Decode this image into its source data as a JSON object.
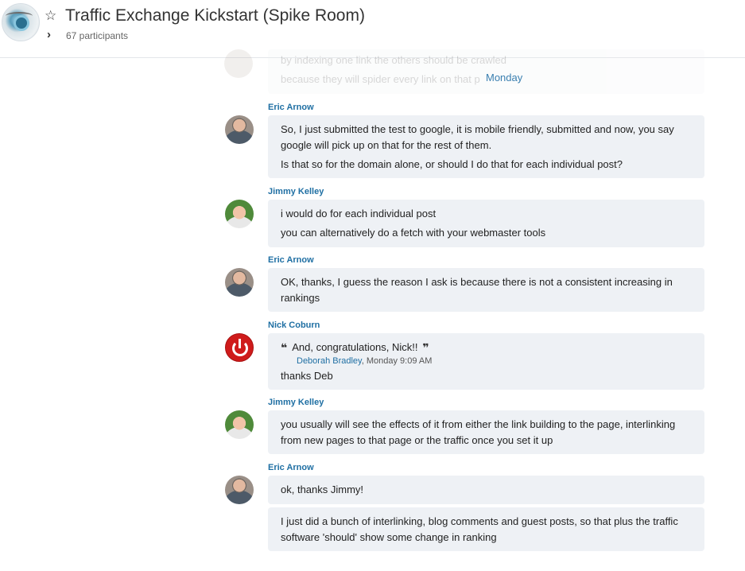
{
  "header": {
    "title": "Traffic Exchange Kickstart (Spike Room)",
    "participants": "67 participants",
    "star_icon": "star-outline-icon",
    "chevron_icon": "chevron-right-icon"
  },
  "faded": {
    "line1": "by indexing one link the others should be crawled",
    "line2": "because they will spider every link on that p"
  },
  "day_separator": "Monday",
  "messages": [
    {
      "sender": "Eric Arnow",
      "lines": [
        "So, I just submitted the test to google, it is mobile friendly, submitted and now, you say google will pick up on that for the rest of them.",
        "Is that so for the domain alone, or should I do that for each individual post?"
      ]
    },
    {
      "sender": "Jimmy Kelley",
      "lines": [
        "i would do for each individual post",
        "you can alternatively do a fetch with your webmaster tools"
      ]
    },
    {
      "sender": "Eric Arnow",
      "lines": [
        "OK, thanks, I guess the reason I ask is because there is not a consistent increasing in rankings"
      ]
    },
    {
      "sender": "Nick Coburn",
      "quote": {
        "text": "And, congratulations, Nick!!",
        "author": "Deborah Bradley",
        "time": ", Monday 9:09 AM"
      },
      "lines": [
        "thanks Deb"
      ]
    },
    {
      "sender": "Jimmy Kelley",
      "lines": [
        "you usually will see the effects of it from either the link building to the page, interlinking from new pages to that page or the traffic once you set it up"
      ]
    },
    {
      "sender": "Eric Arnow",
      "lines": [
        "ok, thanks Jimmy!",
        "I just did a bunch of interlinking, blog comments and guest posts, so that plus the traffic software 'should' show some change in ranking"
      ]
    }
  ],
  "colors": {
    "accent": "#1f6fa3",
    "bubble": "#eef1f5"
  }
}
